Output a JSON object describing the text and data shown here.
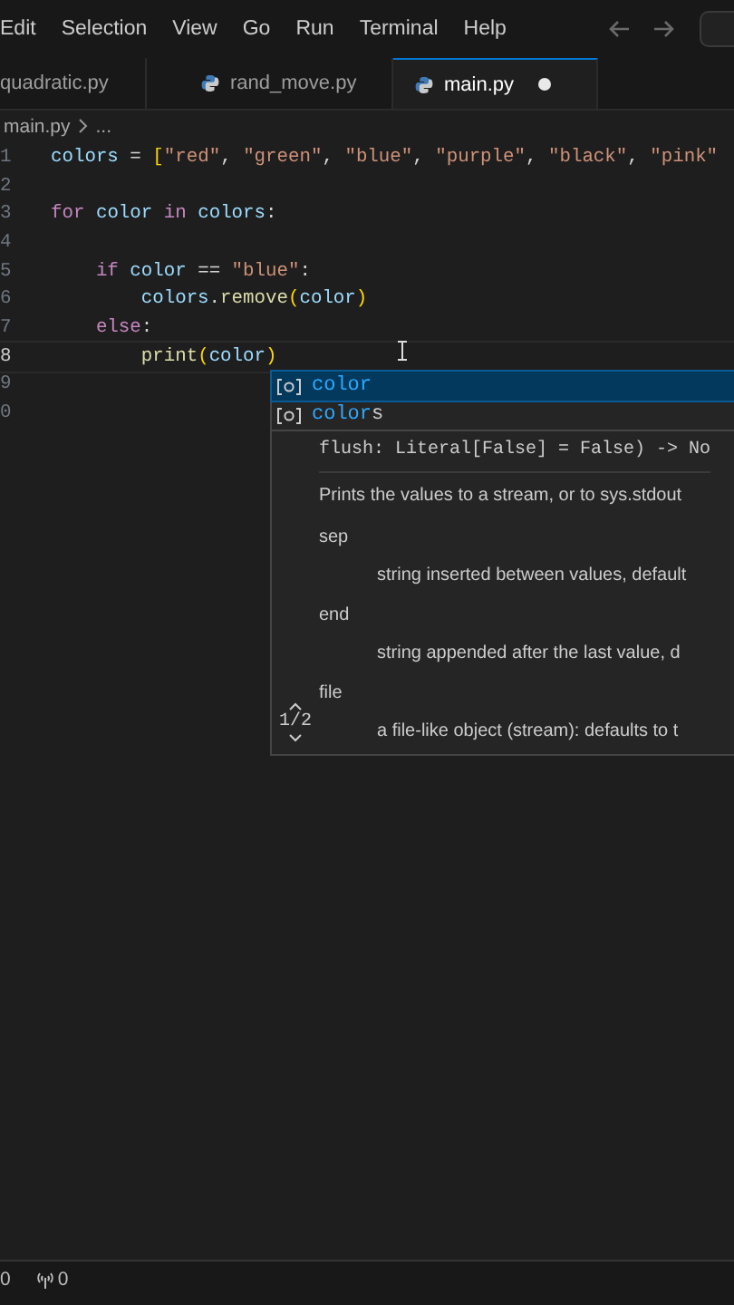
{
  "menu": [
    "Edit",
    "Selection",
    "View",
    "Go",
    "Run",
    "Terminal",
    "Help"
  ],
  "tabs": [
    {
      "label": "quadratic.py",
      "selected": false,
      "modified": false,
      "icon": false
    },
    {
      "label": "rand_move.py",
      "selected": false,
      "modified": false,
      "icon": true
    },
    {
      "label": "main.py",
      "selected": true,
      "modified": true,
      "icon": true
    }
  ],
  "breadcrumb": [
    "main.py",
    "..."
  ],
  "editor": {
    "lines": [
      {
        "number": "1",
        "current": false,
        "tokens": [
          {
            "kind": "var",
            "text": "colors"
          },
          {
            "kind": "op",
            "text": " = "
          },
          {
            "kind": "bracket",
            "text": "["
          },
          {
            "kind": "str",
            "text": "\"red\""
          },
          {
            "kind": "op",
            "text": ", "
          },
          {
            "kind": "str",
            "text": "\"green\""
          },
          {
            "kind": "op",
            "text": ", "
          },
          {
            "kind": "str",
            "text": "\"blue\""
          },
          {
            "kind": "op",
            "text": ", "
          },
          {
            "kind": "str",
            "text": "\"purple\""
          },
          {
            "kind": "op",
            "text": ", "
          },
          {
            "kind": "str",
            "text": "\"black\""
          },
          {
            "kind": "op",
            "text": ", "
          },
          {
            "kind": "str",
            "text": "\"pink\""
          }
        ]
      },
      {
        "number": "2",
        "current": false
      },
      {
        "number": "3",
        "current": false,
        "tokens": [
          {
            "kind": "kw",
            "text": "for"
          },
          {
            "kind": "var",
            "text": " color "
          },
          {
            "kind": "kw",
            "text": "in"
          },
          {
            "kind": "var",
            "text": " colors"
          },
          {
            "kind": "op",
            "text": ":"
          }
        ]
      },
      {
        "number": "4",
        "current": false
      },
      {
        "number": "5",
        "current": false,
        "tokens": [
          {
            "kind": "kw",
            "text": "    if"
          },
          {
            "kind": "var",
            "text": " color"
          },
          {
            "kind": "op",
            "text": " == "
          },
          {
            "kind": "str",
            "text": "\"blue\""
          },
          {
            "kind": "op",
            "text": ":"
          }
        ]
      },
      {
        "number": "6",
        "current": false,
        "tokens": [
          {
            "kind": "var",
            "text": "        colors"
          },
          {
            "kind": "op",
            "text": "."
          },
          {
            "kind": "fn",
            "text": "remove"
          },
          {
            "kind": "bracket",
            "text": "("
          },
          {
            "kind": "var",
            "text": "color"
          },
          {
            "kind": "bracket",
            "text": ")"
          }
        ]
      },
      {
        "number": "7",
        "current": false,
        "tokens": [
          {
            "kind": "kw",
            "text": "    else"
          },
          {
            "kind": "op",
            "text": ":"
          }
        ]
      },
      {
        "number": "8",
        "current": true,
        "tokens": [
          {
            "kind": "fn",
            "text": "        print"
          },
          {
            "kind": "bracket",
            "text": "("
          },
          {
            "kind": "var",
            "text": "color"
          },
          {
            "kind": "bracket",
            "text": ")"
          }
        ]
      },
      {
        "number": "9",
        "current": false
      },
      {
        "number": "0",
        "current": false
      }
    ]
  },
  "suggestions": [
    {
      "matched": "color",
      "selected": true
    },
    {
      "matched": "color",
      "rest": "s",
      "selected": false
    }
  ],
  "doc": {
    "signature": "flush: Literal[False] = False) -> No",
    "description": "Prints the values to a stream, or to sys.stdout",
    "params": [
      {
        "name": "sep",
        "text": "string inserted between values, default"
      },
      {
        "name": "end",
        "text": "string appended after the last value, d"
      },
      {
        "name": "file",
        "text": "a file-like object (stream): defaults to t"
      }
    ],
    "counter": "1/2"
  },
  "status": [
    {
      "kind": "errors",
      "text": "0"
    },
    {
      "kind": "ports",
      "text": "0"
    }
  ]
}
